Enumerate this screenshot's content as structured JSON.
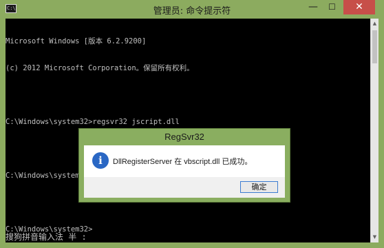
{
  "window": {
    "title": "管理员: 命令提示符",
    "icon_label": "C:\\",
    "minimize_glyph": "—",
    "maximize_glyph": "☐",
    "close_glyph": "✕"
  },
  "console": {
    "lines": [
      "Microsoft Windows [版本 6.2.9200]",
      "(c) 2012 Microsoft Corporation。保留所有权利。",
      "",
      "C:\\Windows\\system32>regsvr32 jscript.dll",
      "",
      "C:\\Windows\\system32>regsvr32 vbscript.dll",
      "",
      "C:\\Windows\\system32>"
    ],
    "ime_status": "搜狗拼音输入法 半 :"
  },
  "scrollbar": {
    "up_glyph": "▲",
    "down_glyph": "▼"
  },
  "dialog": {
    "title": "RegSvr32",
    "icon_glyph": "i",
    "message": "DllRegisterServer 在 vbscript.dll 已成功。",
    "ok_label": "确定"
  },
  "colors": {
    "frame": "#8cab5f",
    "console_bg": "#000000",
    "console_text": "#c0c0c0",
    "close_button": "#c74f49",
    "info_icon": "#2a67c4"
  }
}
